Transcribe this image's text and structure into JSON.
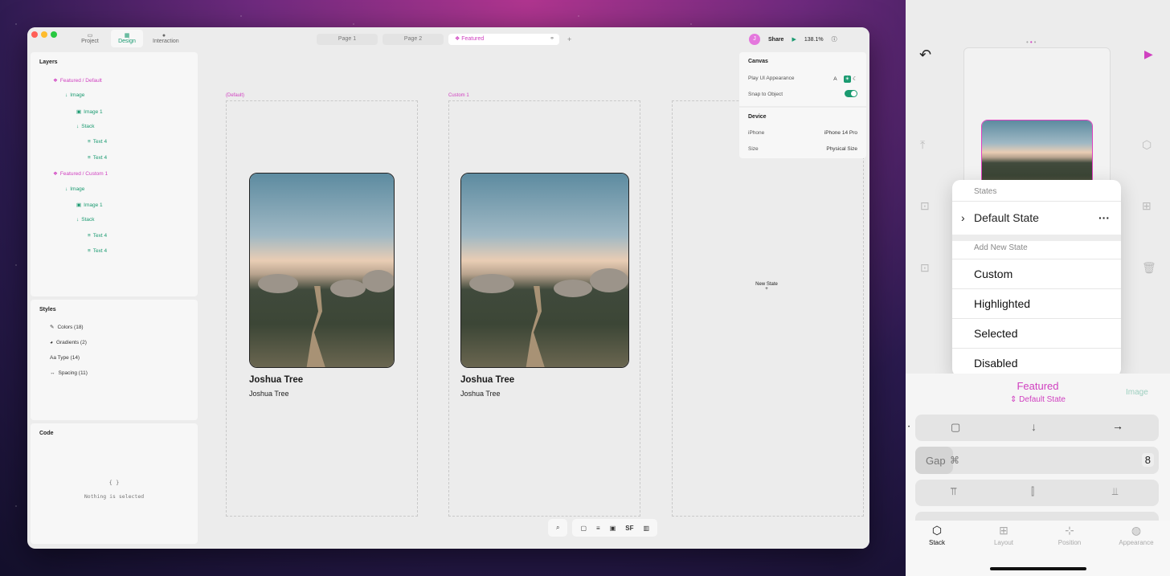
{
  "app": {
    "tabs": [
      {
        "label": "Project",
        "icon": "folder-icon"
      },
      {
        "label": "Design",
        "icon": "design-icon"
      },
      {
        "label": "Interaction",
        "icon": "interaction-icon"
      }
    ],
    "pages": [
      "Page 1",
      "Page 2",
      "Featured"
    ],
    "share": "Share",
    "zoom": "138.1%",
    "avatar": "J"
  },
  "layers": {
    "title": "Layers",
    "items": [
      "Featured / Default",
      "Image",
      "Image 1",
      "Stack",
      "Text 4",
      "Text 4",
      "Featured / Custom 1",
      "Image",
      "Image 1",
      "Stack",
      "Text 4",
      "Text 4"
    ]
  },
  "styles": {
    "title": "Styles",
    "items": [
      "Colors (18)",
      "Gradients (2)",
      "Aa Type (14)",
      "Spacing (11)"
    ]
  },
  "code": {
    "title": "Code",
    "braces": "{ }",
    "empty": "Nothing is selected"
  },
  "canvas": {
    "frame1_label": "(Default)",
    "frame2_label": "Custom 1",
    "card_title": "Joshua Tree",
    "card_sub": "Joshua Tree",
    "new_state": "New State",
    "plus": "+"
  },
  "inspector": {
    "canvas": "Canvas",
    "appearance_label": "Play UI Appearance",
    "appearance_auto": "A",
    "snap_label": "Snap to Object",
    "device": "Device",
    "device_label": "iPhone",
    "device_value": "iPhone 14 Pro",
    "size_label": "Size",
    "size_value": "Physical Size"
  },
  "toolbar": {
    "sf": "SF"
  },
  "ipad": {
    "menu_header": "States",
    "default_state": "Default State",
    "add_header": "Add New State",
    "states": [
      "Custom",
      "Highlighted",
      "Selected",
      "Disabled"
    ],
    "component": "Featured",
    "state_sub": "Default State",
    "image_tab": "Image",
    "gap_label": "Gap",
    "gap_value": "8",
    "tabs": [
      "Stack",
      "Layout",
      "Position",
      "Appearance"
    ]
  },
  "colors": {
    "accent": "#1a9a70",
    "pink": "#d040c0"
  }
}
